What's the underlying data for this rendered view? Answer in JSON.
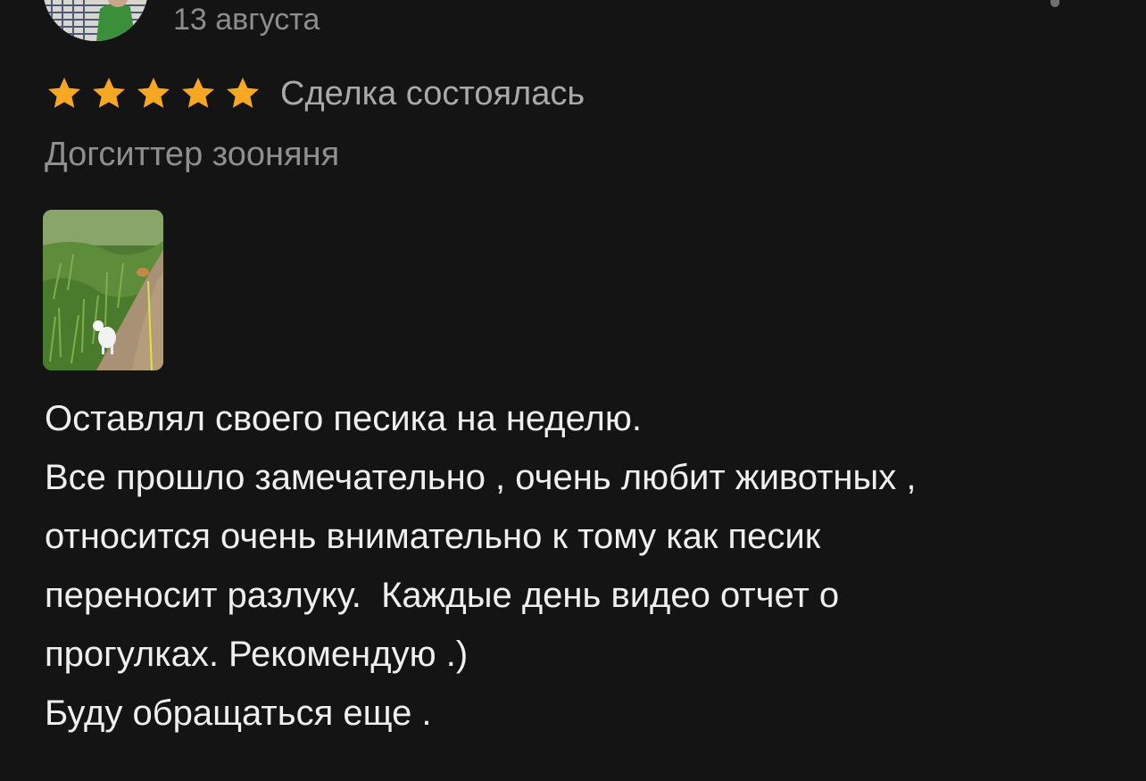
{
  "review": {
    "date": "13 августа",
    "rating": 5,
    "rating_max": 5,
    "deal_status": "Сделка состоялась",
    "service": "Догситтер зооняня",
    "text_lines": [
      "Оставлял своего песика на неделю.",
      "Все прошло замечательно , очень любит животных ,",
      "относится очень внимательно к тому как песик",
      "переносит разлуку.  Каждые день видео отчет о",
      "прогулках. Рекомендую .)",
      "Буду обращаться еще ."
    ]
  },
  "icons": {
    "star": "star-icon",
    "more": "more-icon"
  },
  "colors": {
    "background": "#141414",
    "star": "#f7a823",
    "text": "#efefef",
    "muted": "#8f8f8f"
  }
}
